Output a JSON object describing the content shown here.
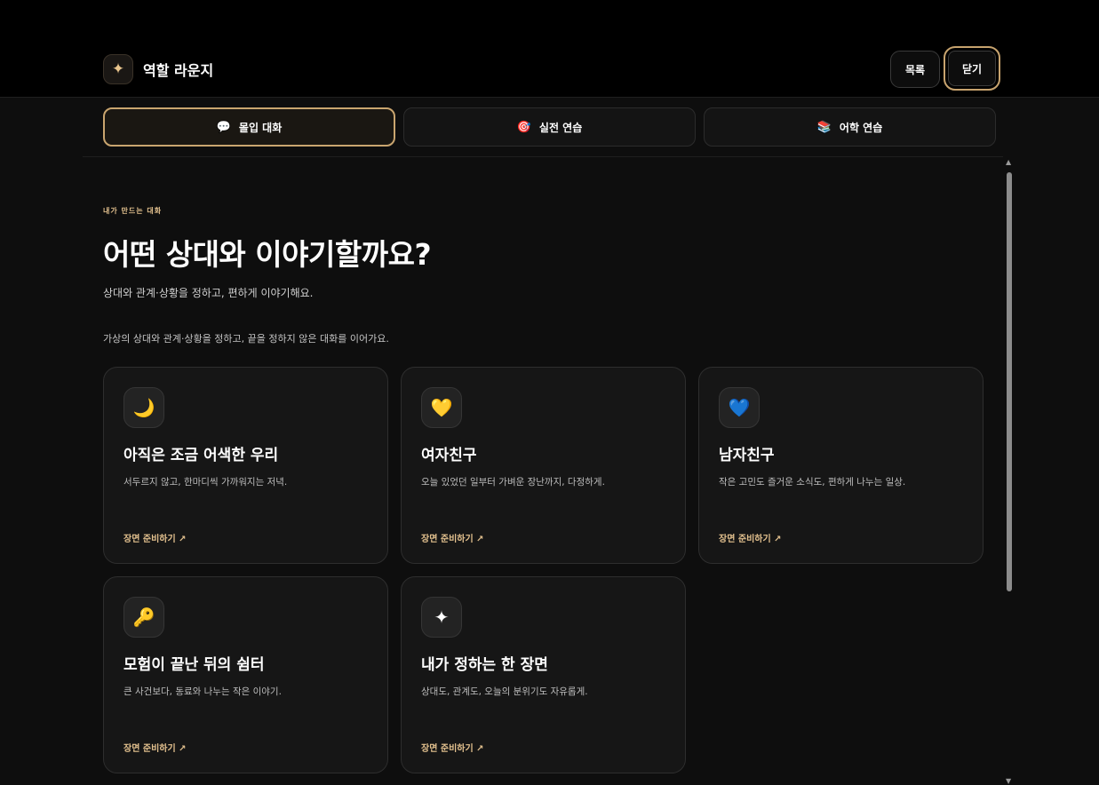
{
  "header": {
    "brand_icon": "sparkle-icon",
    "brand_title": "역할 라운지",
    "list_label": "목록",
    "close_label": "닫기"
  },
  "tabs": [
    {
      "label": "몰입 대화",
      "icon": "speech-bubble-icon",
      "glyph": "💬",
      "active": true
    },
    {
      "label": "실전 연습",
      "icon": "target-icon",
      "glyph": "🎯",
      "active": false
    },
    {
      "label": "어학 연습",
      "icon": "books-icon",
      "glyph": "📚",
      "active": false
    }
  ],
  "intro": {
    "eyebrow": "내가 만드는 대화",
    "title": "어떤 상대와 이야기할까요?",
    "subtitle": "상대와 관계·상황을 정하고, 편하게 이야기해요.",
    "description": "가상의 상대와 관계·상황을 정하고, 끝을 정하지 않은 대화를 이어가요."
  },
  "cards": [
    {
      "icon": "crescent-moon-icon",
      "glyph": "🌙",
      "title": "아직은 조금 어색한 우리",
      "desc": "서두르지 않고, 한마디씩 가까워지는 저녁.",
      "cta": "장면 준비하기 ↗"
    },
    {
      "icon": "yellow-heart-icon",
      "glyph": "💛",
      "title": "여자친구",
      "desc": "오늘 있었던 일부터 가벼운 장난까지, 다정하게.",
      "cta": "장면 준비하기 ↗"
    },
    {
      "icon": "blue-heart-icon",
      "glyph": "💙",
      "title": "남자친구",
      "desc": "작은 고민도 즐거운 소식도, 편하게 나누는 일상.",
      "cta": "장면 준비하기 ↗"
    },
    {
      "icon": "key-icon",
      "glyph": "🔑",
      "title": "모험이 끝난 뒤의 쉼터",
      "desc": "큰 사건보다, 동료와 나누는 작은 이야기.",
      "cta": "장면 준비하기 ↗"
    },
    {
      "icon": "sparkle-icon",
      "glyph": "✦",
      "title": "내가 정하는 한 장면",
      "desc": "상대도, 관계도, 오늘의 분위기도 자유롭게.",
      "cta": "장면 준비하기 ↗"
    }
  ],
  "colors": {
    "accent": "#c9a56f",
    "accent_text": "#e2c08e",
    "background": "#0e0e0e",
    "card": "#161616"
  }
}
